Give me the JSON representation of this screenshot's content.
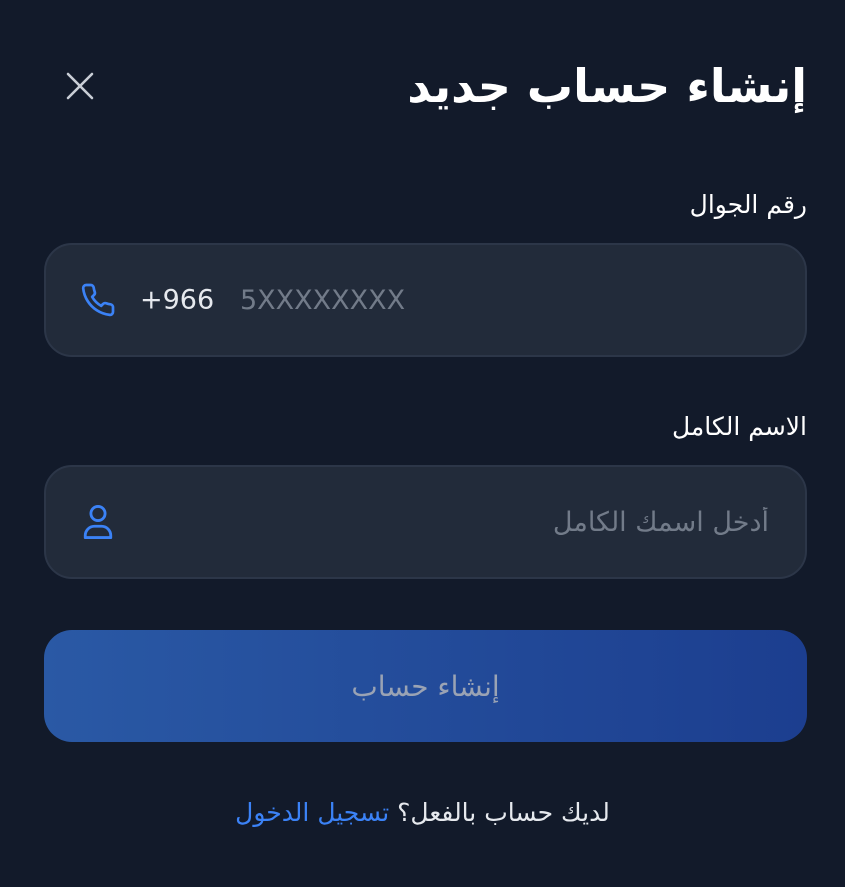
{
  "header": {
    "title": "إنشاء حساب جديد",
    "close_icon": "close-icon"
  },
  "form": {
    "phone": {
      "label": "رقم الجوال",
      "icon": "phone-icon",
      "country_code": "+966",
      "placeholder": "5XXXXXXXX",
      "value": ""
    },
    "name": {
      "label": "الاسم الكامل",
      "icon": "user-icon",
      "placeholder": "أدخل اسمك الكامل",
      "value": ""
    },
    "submit_label": "إنشاء حساب"
  },
  "footer": {
    "text": "لديك حساب بالفعل؟",
    "link_label": "تسجيل الدخول"
  },
  "colors": {
    "background": "#121a2a",
    "field_background": "#222b3a",
    "accent": "#3b82f6",
    "button_gradient_start": "#2a59a5",
    "button_gradient_end": "#1c3e8f"
  }
}
